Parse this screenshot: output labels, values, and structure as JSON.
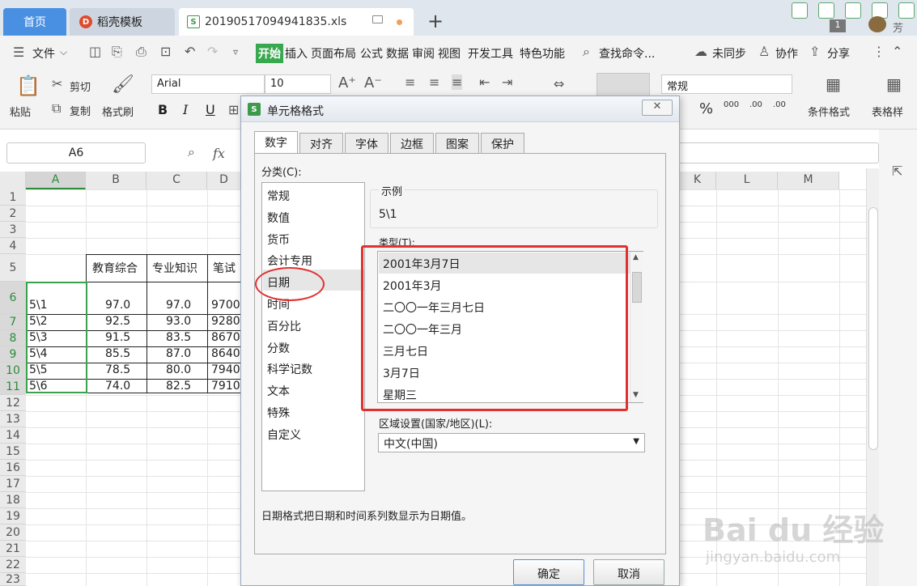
{
  "tabs": {
    "home": "首页",
    "template": "稻壳模板",
    "file": "20190517094941835.xls",
    "badge_count": "1",
    "user_name": "芳"
  },
  "menu": {
    "file": "文件",
    "start": "开始",
    "insert": "插入",
    "page_layout": "页面布局",
    "formula": "公式",
    "data": "数据",
    "review": "审阅",
    "view": "视图",
    "dev_tools": "开发工具",
    "special": "特色功能",
    "search": "查找命令...",
    "unsync": "未同步",
    "collab": "协作",
    "share": "分享"
  },
  "ribbon": {
    "paste": "粘贴",
    "cut": "剪切",
    "copy": "复制",
    "format_painter": "格式刷",
    "font_name": "Arial",
    "font_size": "10",
    "number_format": "常规",
    "bold": "B",
    "italic": "I",
    "underline": "U",
    "percent": "%",
    "cond_format": "条件格式",
    "table_style": "表格样"
  },
  "formula_bar": {
    "cell_ref": "A6",
    "fx": "fx"
  },
  "sheet": {
    "columns": [
      "A",
      "B",
      "C",
      "D",
      "K",
      "L",
      "M"
    ],
    "rows": [
      "1",
      "2",
      "3",
      "4",
      "5",
      "6",
      "7",
      "8",
      "9",
      "10",
      "11",
      "12",
      "13",
      "14",
      "15",
      "16",
      "17",
      "18",
      "19",
      "20",
      "21",
      "22",
      "23"
    ],
    "headers": [
      "教育综合",
      "专业知识",
      "笔试"
    ],
    "data": [
      [
        "5\\1",
        "97.0",
        "97.0",
        "9700"
      ],
      [
        "5\\2",
        "92.5",
        "93.0",
        "9280"
      ],
      [
        "5\\3",
        "91.5",
        "83.5",
        "8670"
      ],
      [
        "5\\4",
        "85.5",
        "87.0",
        "8640"
      ],
      [
        "5\\5",
        "78.5",
        "80.0",
        "7940"
      ],
      [
        "5\\6",
        "74.0",
        "82.5",
        "7910"
      ]
    ]
  },
  "dialog": {
    "title": "单元格格式",
    "close": "✕",
    "tabs": [
      "数字",
      "对齐",
      "字体",
      "边框",
      "图案",
      "保护"
    ],
    "category_label": "分类(C):",
    "categories": [
      "常规",
      "数值",
      "货币",
      "会计专用",
      "日期",
      "时间",
      "百分比",
      "分数",
      "科学记数",
      "文本",
      "特殊",
      "自定义"
    ],
    "selected_category": "日期",
    "sample_label": "示例",
    "sample_value": "5\\1",
    "type_label": "类型(T):",
    "types": [
      "2001年3月7日",
      "2001年3月",
      "二〇〇一年三月七日",
      "二〇〇一年三月",
      "三月七日",
      "3月7日",
      "星期三"
    ],
    "region_label": "区域设置(国家/地区)(L):",
    "region_value": "中文(中国)",
    "description": "日期格式把日期和时间系列数显示为日期值。",
    "ok": "确定",
    "cancel": "取消"
  },
  "watermark": {
    "brand": "Bai du 经验",
    "url": "jingyan.baidu.com"
  }
}
